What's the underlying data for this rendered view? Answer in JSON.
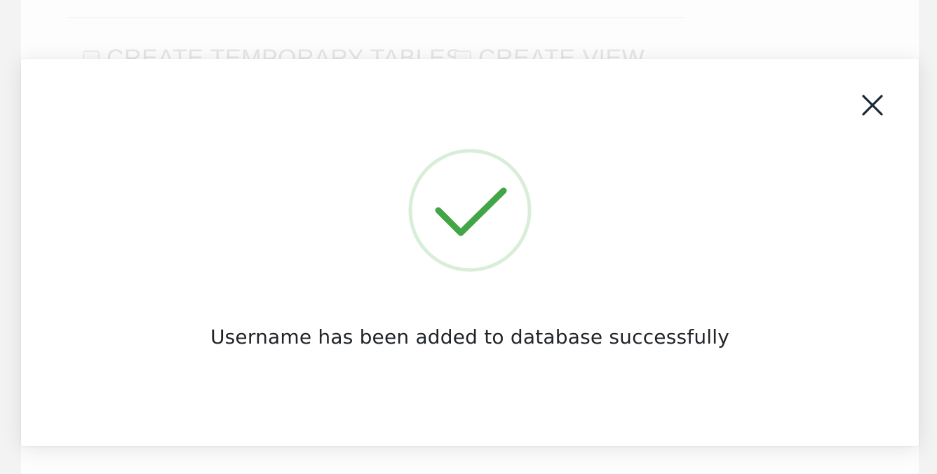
{
  "background": {
    "permissions": [
      {
        "label": "CREATE TEMPORARY TABLES",
        "checked": false
      },
      {
        "label": "CREATE VIEW",
        "checked": false
      }
    ]
  },
  "modal": {
    "close_icon": "close-icon",
    "status_icon": "checkmark-circle-icon",
    "message": "Username has been added to database successfully",
    "colors": {
      "success": "#43a646",
      "success_ring": "#d9eed9",
      "text": "#212529",
      "close": "#1e2a33"
    }
  }
}
